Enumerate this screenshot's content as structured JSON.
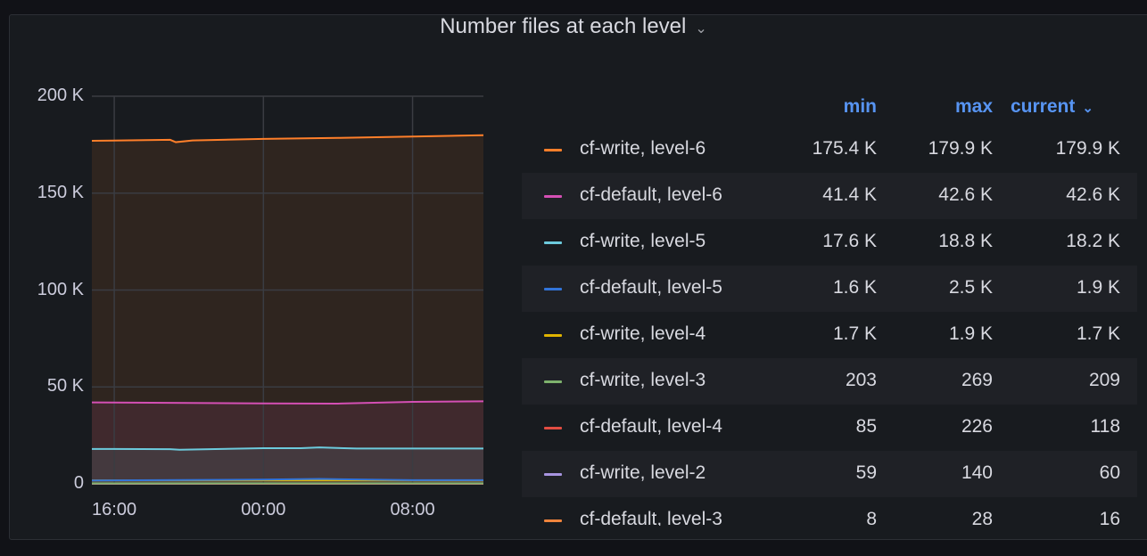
{
  "panel": {
    "title": "Number files at each level"
  },
  "chart_data": {
    "type": "line",
    "title": "Number files at each level",
    "xlabel": "",
    "ylabel": "",
    "x_unit": "hours since 16:00",
    "xlim": [
      -1.2,
      19.8
    ],
    "ylim": [
      0,
      200000
    ],
    "y_ticks": [
      "0",
      "50 K",
      "100 K",
      "150 K",
      "200 K"
    ],
    "y_tick_values": [
      0,
      50000,
      100000,
      150000,
      200000
    ],
    "x_ticks": [
      "16:00",
      "00:00",
      "08:00"
    ],
    "x_tick_values": [
      0,
      8,
      16
    ],
    "grid": true,
    "legend_placement": "right",
    "series": [
      {
        "name": "cf-write, level-6",
        "color": "#ff7f2a",
        "x": [
          -1.2,
          3,
          3.3,
          4.2,
          8,
          12,
          16,
          19.8
        ],
        "y": [
          177000,
          177500,
          176300,
          177200,
          178000,
          178500,
          179200,
          179900
        ]
      },
      {
        "name": "cf-default, level-6",
        "color": "#d44fb4",
        "x": [
          -1.2,
          3,
          8,
          12,
          16,
          19.8
        ],
        "y": [
          42000,
          41800,
          41500,
          41400,
          42300,
          42600
        ]
      },
      {
        "name": "cf-write, level-5",
        "color": "#6ccadc",
        "x": [
          -1.2,
          3,
          3.5,
          8,
          10,
          11,
          13,
          16,
          19.8
        ],
        "y": [
          18000,
          17900,
          17600,
          18400,
          18400,
          18800,
          18200,
          18200,
          18200
        ]
      },
      {
        "name": "cf-default, level-5",
        "color": "#3274d9",
        "x": [
          -1.2,
          8,
          11,
          16,
          19.8
        ],
        "y": [
          1700,
          2200,
          2500,
          1900,
          1900
        ]
      },
      {
        "name": "cf-write, level-4",
        "color": "#e0b400",
        "x": [
          -1.2,
          8,
          19.8
        ],
        "y": [
          1800,
          1800,
          1700
        ]
      },
      {
        "name": "cf-write, level-3",
        "color": "#7eb26d",
        "x": [
          -1.2,
          19.8
        ],
        "y": [
          220,
          209
        ]
      },
      {
        "name": "cf-default, level-4",
        "color": "#e24d42",
        "x": [
          -1.2,
          19.8
        ],
        "y": [
          150,
          118
        ]
      },
      {
        "name": "cf-write, level-2",
        "color": "#a794e0",
        "x": [
          -1.2,
          19.8
        ],
        "y": [
          80,
          60
        ]
      },
      {
        "name": "cf-default, level-3",
        "color": "#ef843c",
        "x": [
          -1.2,
          19.8
        ],
        "y": [
          20,
          16
        ]
      }
    ]
  },
  "legend": {
    "headers": {
      "min": "min",
      "max": "max",
      "current": "current"
    },
    "sort_icon": "chevron-down-icon",
    "rows": [
      {
        "name": "cf-write, level-6",
        "color": "#ff7f2a",
        "min": "175.4 K",
        "max": "179.9 K",
        "current": "179.9 K"
      },
      {
        "name": "cf-default, level-6",
        "color": "#d44fb4",
        "min": "41.4 K",
        "max": "42.6 K",
        "current": "42.6 K"
      },
      {
        "name": "cf-write, level-5",
        "color": "#6ccadc",
        "min": "17.6 K",
        "max": "18.8 K",
        "current": "18.2 K"
      },
      {
        "name": "cf-default, level-5",
        "color": "#3274d9",
        "min": "1.6 K",
        "max": "2.5 K",
        "current": "1.9 K"
      },
      {
        "name": "cf-write, level-4",
        "color": "#e0b400",
        "min": "1.7 K",
        "max": "1.9 K",
        "current": "1.7 K"
      },
      {
        "name": "cf-write, level-3",
        "color": "#7eb26d",
        "min": "203",
        "max": "269",
        "current": "209"
      },
      {
        "name": "cf-default, level-4",
        "color": "#e24d42",
        "min": "85",
        "max": "226",
        "current": "118"
      },
      {
        "name": "cf-write, level-2",
        "color": "#a794e0",
        "min": "59",
        "max": "140",
        "current": "60"
      },
      {
        "name": "cf-default, level-3",
        "color": "#ef843c",
        "min": "8",
        "max": "28",
        "current": "16"
      }
    ]
  }
}
